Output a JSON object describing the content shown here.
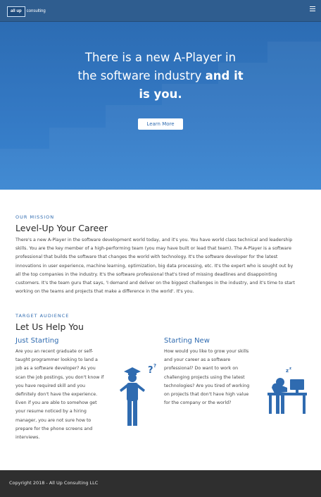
{
  "nav": {
    "logo_box": "all up",
    "logo_text": "consulting"
  },
  "hero": {
    "title_line1": "There is a new A-Player in",
    "title_line2_plain": "the software industry ",
    "title_line2_bold": "and it",
    "title_line3": "is you.",
    "button_label": "Learn More"
  },
  "mission": {
    "label": "OUR MISSION",
    "heading": "Level-Up Your Career",
    "lines": [
      "There's a new A-Player in the software development world today, and it's you. You have world class technical and leadership",
      "skills. You are the key member of a high-performing team (you may have built or lead that team). The A-Player is a software",
      "professional that builds the software that changes the world with technology. It's the software developer for the latest",
      "innovations in user experience, machine learning, optimization, big data processing, etc. It's the expert who is sought out by",
      "all the top companies in the industry. It's the software professional that's tired of missing deadlines and disappointing",
      "customers. It's the team guru that says, 'I demand and deliver on the biggest challenges in the industry, and it's time to start",
      "working on the teams and projects that make a difference in the world'. It's you."
    ]
  },
  "audience": {
    "label": "TARGET AUDIENCE",
    "heading": "Let Us Help You",
    "just_starting": {
      "title": "Just Starting",
      "lines": [
        "Are you an recent graduate or self-",
        "taught programmer looking to land a",
        "job as a software developer? As you",
        "scan the job postings, you don't know if",
        "you have required skill and you",
        "definitely don't have the experience.",
        "Even if you are able to somehow get",
        "your resume noticed by a hiring",
        "manager, you are not sure how to",
        "prepare for the phone screens and",
        "interviews."
      ]
    },
    "starting_new": {
      "title": "Starting New",
      "lines": [
        "How would you like to grow your skills",
        "and your career as a software",
        "professional? Do want to work on",
        "challenging projects using the latest",
        "technologies? Are you tired of working",
        "on projects that don't have high value",
        "for the company or the world?"
      ]
    }
  },
  "footer": {
    "text": "Copyright 2018 - All Up Consulting LLC"
  },
  "colors": {
    "nav": "#2f5d8f",
    "hero": "#3479c4",
    "accent": "#2f6bb0",
    "footer": "#2f2f2f"
  }
}
